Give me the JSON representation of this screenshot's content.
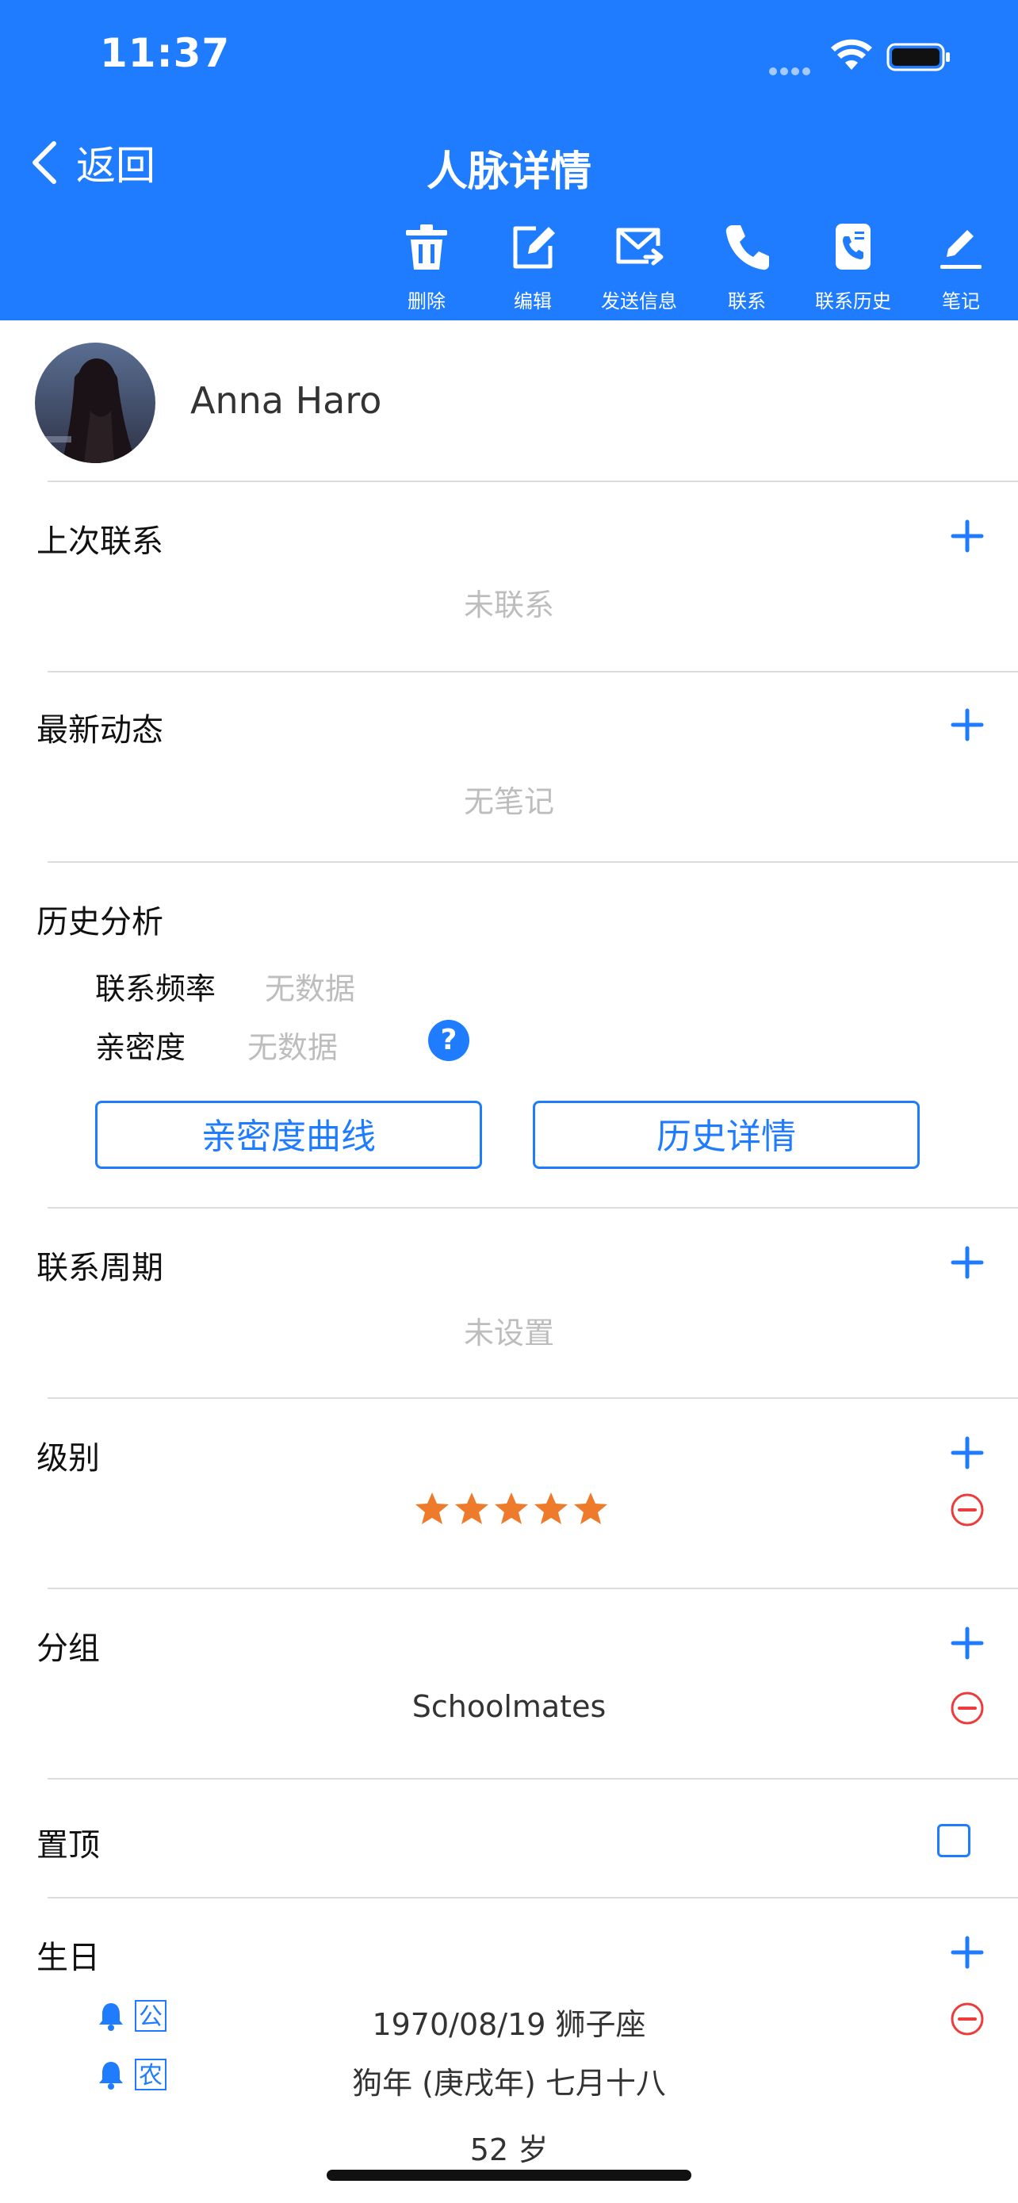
{
  "status_bar": {
    "time": "11:37"
  },
  "nav": {
    "back_label": "返回",
    "title": "人脉详情"
  },
  "toolbar": [
    {
      "label": "删除",
      "icon": "trash-icon"
    },
    {
      "label": "编辑",
      "icon": "edit-icon"
    },
    {
      "label": "发送信息",
      "icon": "send-mail-icon"
    },
    {
      "label": "联系",
      "icon": "phone-icon"
    },
    {
      "label": "联系历史",
      "icon": "call-history-icon"
    },
    {
      "label": "笔记",
      "icon": "note-pen-icon"
    }
  ],
  "contact": {
    "name": "Anna Haro"
  },
  "last_contact": {
    "title": "上次联系",
    "placeholder": "未联系"
  },
  "latest_news": {
    "title": "最新动态",
    "placeholder": "无笔记"
  },
  "history": {
    "title": "历史分析",
    "frequency_label": "联系频率",
    "frequency_value": "无数据",
    "intimacy_label": "亲密度",
    "intimacy_value": "无数据",
    "help": "?",
    "curve_button": "亲密度曲线",
    "details_button": "历史详情"
  },
  "contact_cycle": {
    "title": "联系周期",
    "placeholder": "未设置"
  },
  "level": {
    "title": "级别",
    "stars": 5,
    "max_stars": 5
  },
  "group": {
    "title": "分组",
    "value": "Schoolmates"
  },
  "pin": {
    "title": "置顶",
    "checked": false
  },
  "birthday": {
    "title": "生日",
    "solar_tag": "公",
    "solar_value": "1970/08/19 狮子座",
    "lunar_tag": "农",
    "lunar_value": "狗年 (庚戌年) 七月十八",
    "age": "52 岁"
  },
  "colors": {
    "accent": "#1f7cff",
    "placeholder_gray": "#bdbdbd",
    "star_orange": "#ee7b2b",
    "remove_red": "#ee3b3b"
  }
}
